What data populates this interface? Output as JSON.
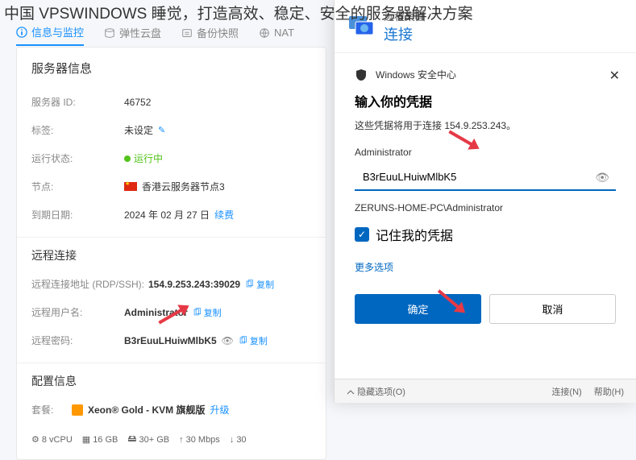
{
  "page_title": "中国 VPSWINDOWS 睡觉，打造高效、稳定、安全的服务器解决方案",
  "tabs": [
    {
      "label": "信息与监控",
      "icon": "info-icon"
    },
    {
      "label": "弹性云盘",
      "icon": "disk-icon"
    },
    {
      "label": "备份快照",
      "icon": "backup-icon"
    },
    {
      "label": "NAT",
      "icon": "nat-icon"
    }
  ],
  "server_info": {
    "section_title": "服务器信息",
    "id_label": "服务器 ID:",
    "id_value": "46752",
    "tag_label": "标签:",
    "tag_value": "未设定",
    "status_label": "运行状态:",
    "status_value": "运行中",
    "node_label": "节点:",
    "node_value": "香港云服务器节点3",
    "expire_label": "到期日期:",
    "expire_value": "2024 年 02 月 27 日",
    "renew_label": "续费"
  },
  "remote_conn": {
    "section_title": "远程连接",
    "addr_label": "远程连接地址 (RDP/SSH):",
    "addr_value": "154.9.253.243:39029",
    "user_label": "远程用户名:",
    "user_value": "Administrator",
    "pass_label": "远程密码:",
    "pass_value": "B3rEuuLHuiwMlbK5",
    "copy_label": "复制"
  },
  "config_info": {
    "section_title": "配置信息",
    "plan_label": "套餐:",
    "plan_value": "Xeon® Gold - KVM 旗舰版",
    "upgrade_label": "升级",
    "specs": {
      "cpu": "8 vCPU",
      "ram": "16 GB",
      "disk": "30+ GB",
      "bw": "30 Mbps",
      "extra": "30"
    }
  },
  "rdp": {
    "title1": "远程桌面",
    "title2": "连接",
    "security_center": "Windows 安全中心",
    "cred_title": "输入你的凭据",
    "cred_desc": "这些凭据将用于连接 154.9.253.243。",
    "username_label": "Administrator",
    "password_value": "B3rEuuLHuiwMlbK5",
    "domain_user": "ZERUNS-HOME-PC\\Administrator",
    "remember_label": "记住我的凭据",
    "more_options": "更多选项",
    "ok_btn": "确定",
    "cancel_btn": "取消",
    "hide_options": "隐藏选项(O)",
    "connect_btn": "连接(N)",
    "help_btn": "帮助(H)"
  },
  "tiny": "更"
}
